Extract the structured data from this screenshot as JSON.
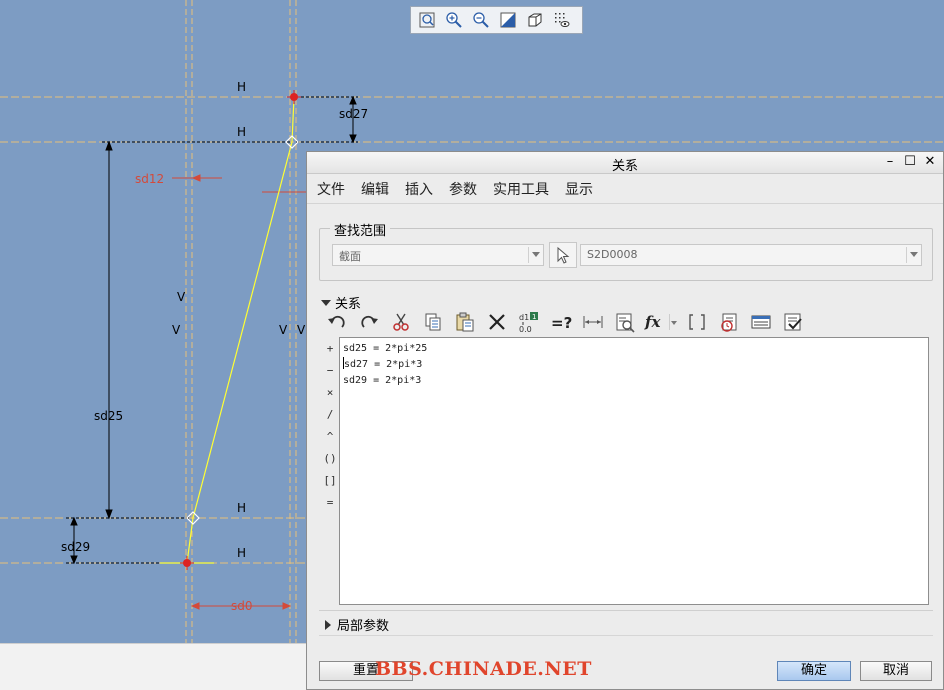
{
  "sketch": {
    "labels": {
      "h_top_1": "H",
      "h_top_2": "H",
      "h_bottom_1": "H",
      "h_bottom_2": "H",
      "v_1": "V",
      "v_2": "V",
      "v_3": "V",
      "v_4": "V",
      "dim_sd27": "sd27",
      "dim_sd12": "sd12",
      "dim_sd25": "sd25",
      "dim_sd29": "sd29",
      "dim_sd0": "sd0"
    },
    "colors": {
      "background": "#7d9cc3",
      "centerline": "#e8c07a",
      "construction": "#ffffff",
      "geometry": "#ffff33",
      "dimension": "#000000",
      "weak_dimension": "#d44a3a",
      "point": "#dd2222"
    }
  },
  "view_toolbar": {
    "icons": [
      "zoom-fit-icon",
      "zoom-in-icon",
      "zoom-out-icon",
      "repaint-icon",
      "display-style-icon",
      "saved-view-icon"
    ]
  },
  "dialog": {
    "title": "关系",
    "window_controls": {
      "minimize": "–",
      "maximize": "☐",
      "close": "✕"
    },
    "menu": [
      "文件",
      "编辑",
      "插入",
      "参数",
      "实用工具",
      "显示"
    ],
    "scope": {
      "legend": "查找范围",
      "type_value": "截面",
      "object_value": "S2D0008"
    },
    "relations": {
      "header": "关系",
      "operators": [
        "+",
        "−",
        "×",
        "/",
        "^",
        "()",
        "[]",
        "="
      ],
      "lines": [
        "sd25 = 2*pi*25",
        "sd27 = 2*pi*3",
        "sd29 = 2*pi*3"
      ]
    },
    "local_params": "局部参数",
    "buttons": {
      "reset": "重置",
      "ok": "确定",
      "cancel": "取消"
    },
    "watermark": "BBS.CHINADE.NET"
  }
}
